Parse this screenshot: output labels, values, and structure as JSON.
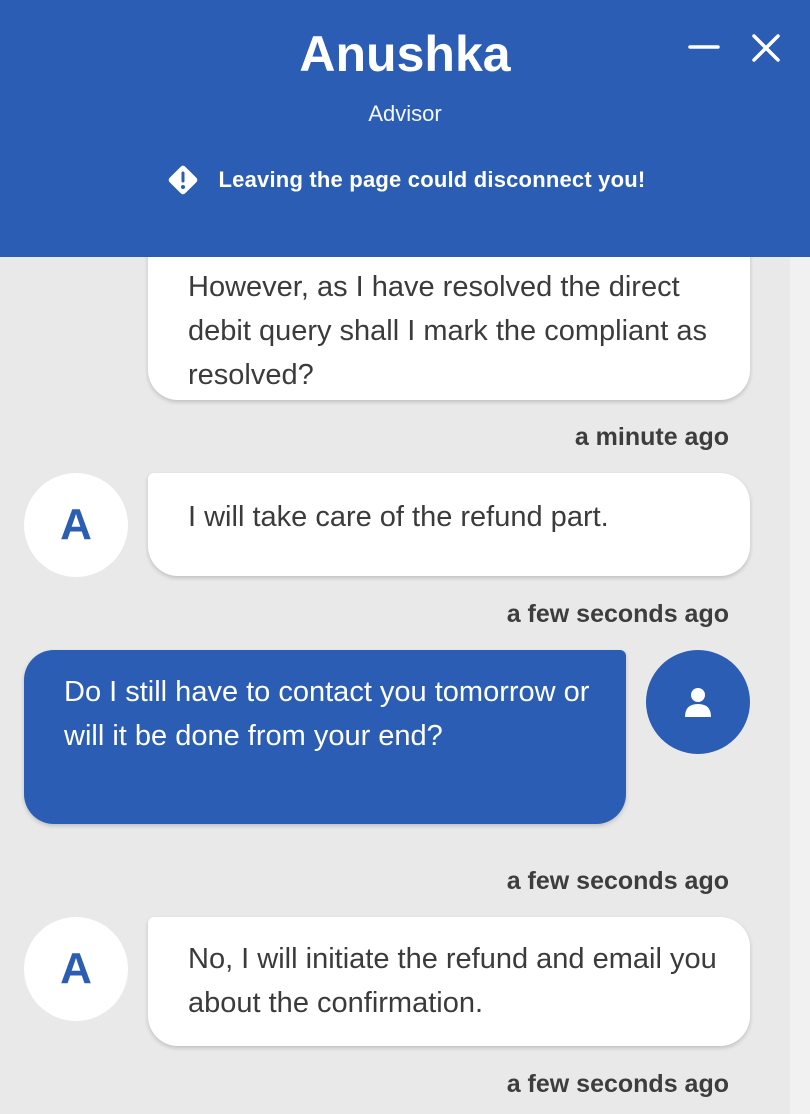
{
  "header": {
    "agent_name": "Anushka",
    "agent_role": "Advisor",
    "warning_text": "Leaving the page could disconnect you!",
    "minimize_icon": "minimize-icon",
    "close_icon": "close-icon",
    "bg_color": "#2a5db3"
  },
  "messages": [
    {
      "sender": "agent",
      "text": "However, as I have resolved the direct debit query shall I mark the compliant as resolved?",
      "timestamp": "a minute ago"
    },
    {
      "sender": "agent",
      "avatar_initial": "A",
      "text": "I will take care of the refund part.",
      "timestamp": "a few seconds ago"
    },
    {
      "sender": "user",
      "avatar_icon": "user-icon",
      "text": "Do I still have to contact you tomorrow or will it be done from your end?",
      "timestamp": "a few seconds ago"
    },
    {
      "sender": "agent",
      "avatar_initial": "A",
      "text": "No, I will initiate the refund and email you about the confirmation.",
      "timestamp": "a few seconds ago"
    }
  ]
}
